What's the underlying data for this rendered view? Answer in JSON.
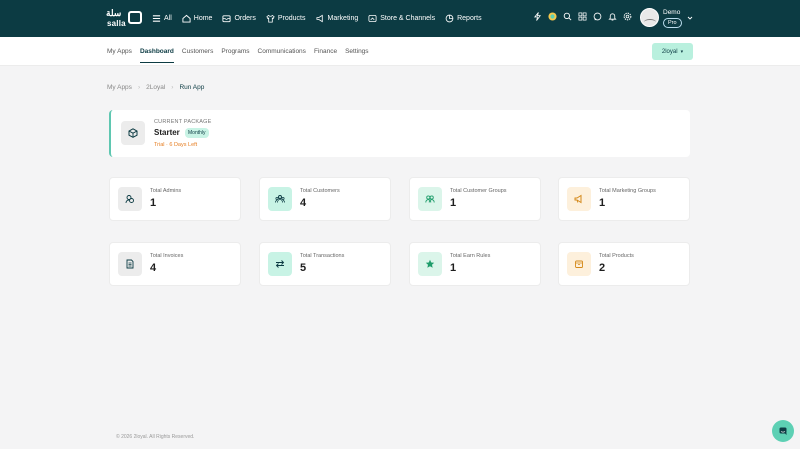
{
  "brand": {
    "logo_arabic": "سلة",
    "logo_latin": "salla"
  },
  "topnav": {
    "items": [
      {
        "label": "All",
        "icon": "menu-icon"
      },
      {
        "label": "Home",
        "icon": "home-icon"
      },
      {
        "label": "Orders",
        "icon": "inbox-icon"
      },
      {
        "label": "Products",
        "icon": "shirt-icon"
      },
      {
        "label": "Marketing",
        "icon": "megaphone-icon"
      },
      {
        "label": "Store & Channels",
        "icon": "store-icon"
      },
      {
        "label": "Reports",
        "icon": "chart-icon"
      }
    ],
    "icons": [
      "lightning-icon",
      "ai-spark-icon",
      "search-icon",
      "apps-grid-icon",
      "chat-icon",
      "bell-icon",
      "gear-icon"
    ]
  },
  "user": {
    "name": "Demo",
    "plan": "Pro"
  },
  "subnav": {
    "tabs": [
      "My Apps",
      "Dashboard",
      "Customers",
      "Programs",
      "Communications",
      "Finance",
      "Settings"
    ],
    "active": "Dashboard",
    "app_selector": "2loyal"
  },
  "breadcrumb": [
    "My Apps",
    "2Loyal",
    "Run App"
  ],
  "package": {
    "label": "CURRENT PACKAGE",
    "name": "Starter",
    "period": "Monthly",
    "trial": "Trial · 6 Days Left"
  },
  "stats": [
    {
      "label": "Total Admins",
      "value": "1",
      "icon": "admins-icon",
      "bg": "#ececec",
      "fg": "#0c3b43"
    },
    {
      "label": "Total Customers",
      "value": "4",
      "icon": "customers-icon",
      "bg": "#c8f3e5",
      "fg": "#0c3b43"
    },
    {
      "label": "Total Customer Groups",
      "value": "1",
      "icon": "groups-icon",
      "bg": "#dbf5ea",
      "fg": "#1f9d6b"
    },
    {
      "label": "Total Marketing Groups",
      "value": "1",
      "icon": "megaphone-icon",
      "bg": "#fdf0dc",
      "fg": "#d4891a"
    },
    {
      "label": "Total Invoices",
      "value": "4",
      "icon": "invoice-icon",
      "bg": "#ececec",
      "fg": "#0c3b43"
    },
    {
      "label": "Total Transactions",
      "value": "5",
      "icon": "transfer-icon",
      "bg": "#c8f3e5",
      "fg": "#0c3b43"
    },
    {
      "label": "Total Earn Rules",
      "value": "1",
      "icon": "star-icon",
      "bg": "#dbf5ea",
      "fg": "#1f9d6b"
    },
    {
      "label": "Total Products",
      "value": "2",
      "icon": "box-icon",
      "bg": "#fdf0dc",
      "fg": "#d4891a"
    }
  ],
  "footer": "© 2026 2loyal. All Rights Reserved.",
  "colors": {
    "topbar": "#0c3b43",
    "accent": "#5fc7b1",
    "selector_bg": "#b9f0de"
  }
}
